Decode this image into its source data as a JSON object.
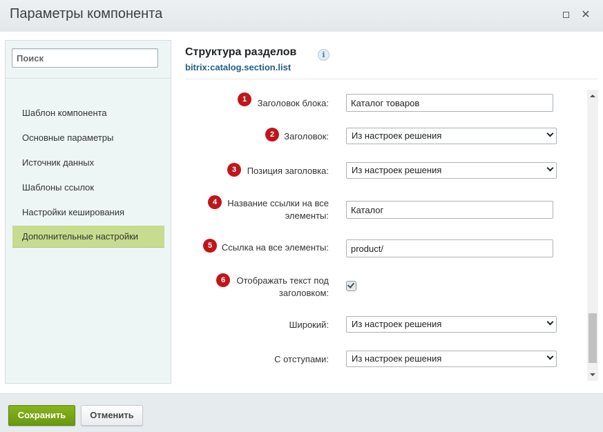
{
  "window": {
    "title": "Параметры компонента"
  },
  "sidebar": {
    "search_placeholder": "Поиск",
    "items": [
      {
        "label": "Шаблон компонента"
      },
      {
        "label": "Основные параметры"
      },
      {
        "label": "Источник данных"
      },
      {
        "label": "Шаблоны ссылок"
      },
      {
        "label": "Настройки кеширования"
      },
      {
        "label": "Дополнительные настройки",
        "active": true
      }
    ]
  },
  "header": {
    "title": "Структура разделов",
    "subtitle": "bitrix:catalog.section.list",
    "info_icon": "i"
  },
  "form": {
    "rows": [
      {
        "badge": "1",
        "label": "Заголовок блока:",
        "type": "text",
        "value": "Каталог товаров"
      },
      {
        "badge": "2",
        "label": "Заголовок:",
        "type": "select",
        "value": "Из настроек решения"
      },
      {
        "badge": "3",
        "label": "Позиция заголовка:",
        "type": "select",
        "value": "Из настроек решения"
      },
      {
        "badge": "4",
        "label_line1": "Название ссылки на все",
        "label_line2": "элементы:",
        "type": "text",
        "value": "Каталог"
      },
      {
        "badge": "5",
        "label": "Ссылка на все элементы:",
        "type": "text",
        "value": "product/"
      },
      {
        "badge": "6",
        "label_line1": "Отображать текст под",
        "label_line2": "заголовком:",
        "type": "checkbox",
        "checked": true
      },
      {
        "label": "Широкий:",
        "type": "select",
        "value": "Из настроек решения"
      },
      {
        "label": "С отступами:",
        "type": "select",
        "value": "Из настроек решения"
      }
    ]
  },
  "footer": {
    "save_label": "Сохранить",
    "cancel_label": "Отменить"
  },
  "colors": {
    "badge": "#c0161b",
    "active_nav": "#c7dc8e",
    "save_button": "#7aa617",
    "link_blue": "#245d8a"
  },
  "icons": {
    "maximize": "maximize-icon",
    "close": "close-icon",
    "info": "info-icon",
    "dropdown": "chevron-down-icon",
    "check": "check-icon"
  }
}
